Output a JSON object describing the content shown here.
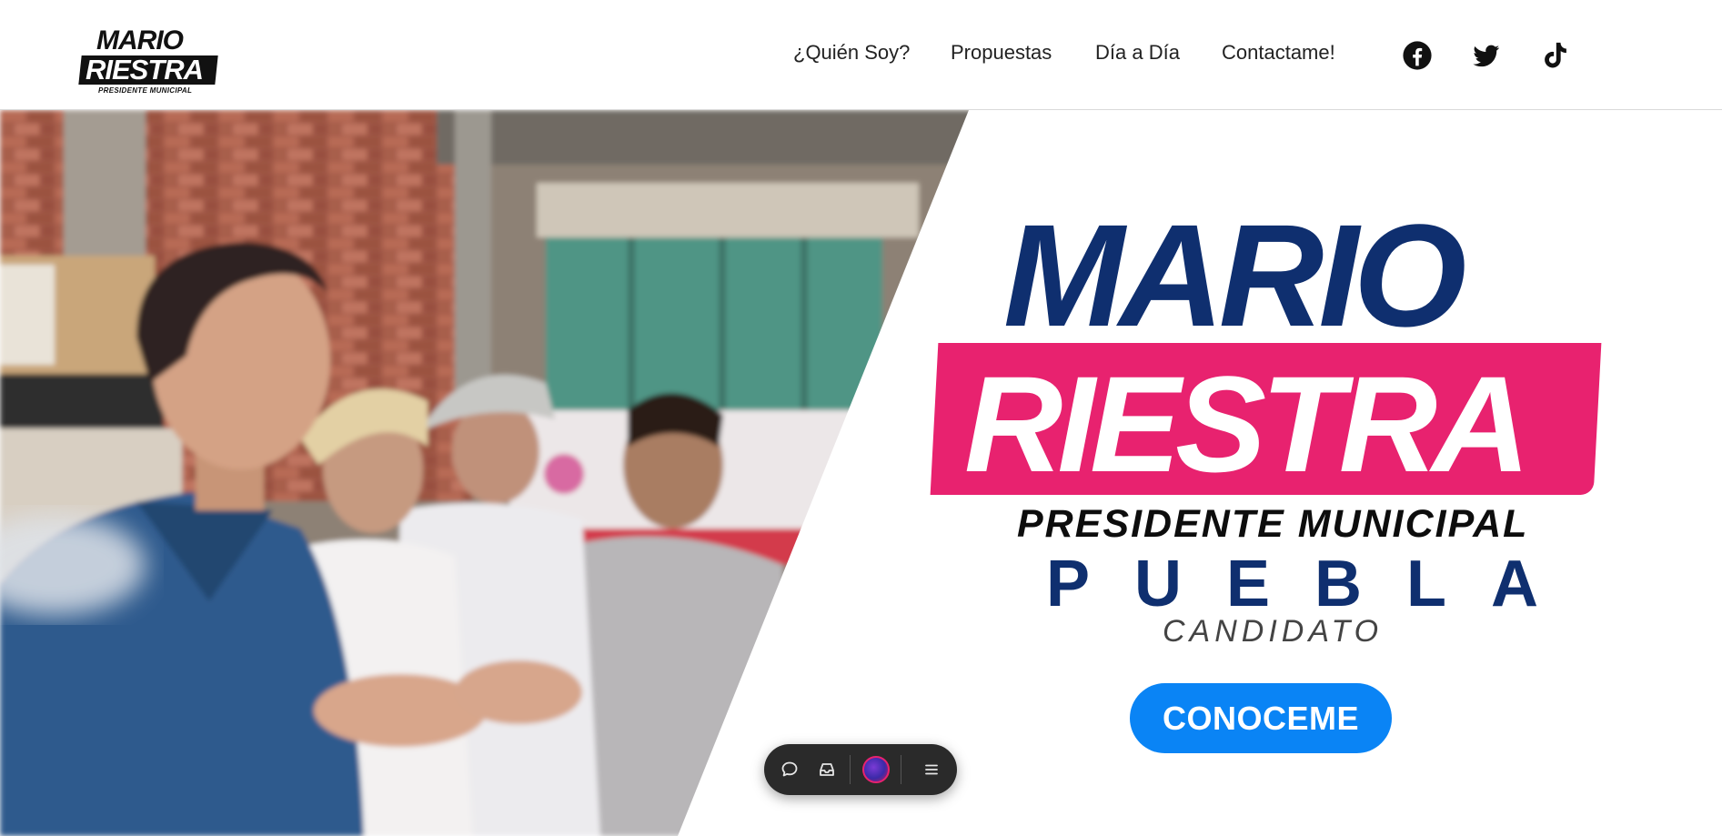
{
  "header": {
    "logo": {
      "line1": "MARIO",
      "line2": "RIESTRA",
      "line3": "PRESIDENTE MUNICIPAL"
    },
    "nav": [
      {
        "label": "¿Quién Soy?"
      },
      {
        "label": "Propuestas"
      },
      {
        "label": "Día a Día"
      },
      {
        "label": "Contactame!"
      }
    ],
    "social": [
      {
        "icon": "facebook-icon"
      },
      {
        "icon": "twitter-icon"
      },
      {
        "icon": "tiktok-icon"
      }
    ]
  },
  "hero": {
    "name_first": "MARIO",
    "name_last": "RIESTRA",
    "title": "PRESIDENTE MUNICIPAL",
    "city": "PUEBLA",
    "role": "CANDIDATO",
    "cta_label": "CONOCEME"
  },
  "toolbar": {
    "items": [
      {
        "icon": "chat-bubble-icon"
      },
      {
        "icon": "inbox-icon"
      },
      {
        "icon": "avatar"
      },
      {
        "icon": "menu-icon"
      }
    ]
  },
  "colors": {
    "navy": "#0f2f6f",
    "pink": "#e8226f",
    "cta_blue": "#0a84f5",
    "toolbar_bg": "#2a2a2a"
  }
}
